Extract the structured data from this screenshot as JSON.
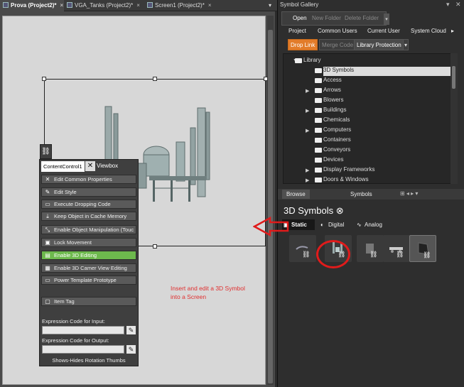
{
  "editor": {
    "tabs": [
      {
        "label": "Prova (Project2)*",
        "close": "×"
      },
      {
        "label": "VGA_Tanks (Project2)*",
        "close": "×"
      },
      {
        "label": "Screen1 (Project2)*",
        "close": "×"
      }
    ],
    "overflow": "▾"
  },
  "context_menu": {
    "title": "ContentControl1",
    "viewbox": "Viewbox",
    "items": [
      {
        "label": "Edit Common Properties",
        "icon": "wrench-icon",
        "glyph": "✕"
      },
      {
        "label": "Edit Style",
        "icon": "style-icon",
        "glyph": "✎"
      },
      {
        "label": "Execute Dropping Code",
        "icon": "code-icon",
        "glyph": "▭"
      },
      {
        "label": "Keep Object in Cache Memory",
        "icon": "download-icon",
        "glyph": "⤓"
      },
      {
        "label": "Enable Object Manipulation (Touc",
        "icon": "resize-icon",
        "glyph": "⤡"
      },
      {
        "label": "Lock Movement",
        "icon": "lock-icon",
        "glyph": "▣"
      },
      {
        "label": "Enable 3D Editing",
        "icon": "cube-icon",
        "glyph": "▤"
      },
      {
        "label": "Enable 3D Camer View Editing",
        "icon": "camera-icon",
        "glyph": "▦"
      },
      {
        "label": "Power Template Prototype",
        "icon": "template-icon",
        "glyph": "▭"
      },
      {
        "label": "Item Tag",
        "icon": "tag-icon",
        "glyph": "▢"
      }
    ],
    "input_label": "Expression Code for Input:",
    "output_label": "Expression Code for Output:",
    "input_value": "",
    "output_value": "",
    "footer": "Shows-Hides Rotation Thumbs",
    "active_color": "#6db94d"
  },
  "annotation": "Insert and edit a 3D Symbol into a Screen",
  "gallery": {
    "title": "Symbol Gallery",
    "pin": "▾",
    "close": "✕",
    "toolbar": {
      "open": "Open",
      "new_folder": "New Folder",
      "delete_folder": "Delete Folder",
      "more": "▾"
    },
    "nav_tabs": [
      "Project",
      "Common Users",
      "Current User",
      "System Cloud"
    ],
    "nav_more": "▸",
    "toolbar2": {
      "drop_link": "Drop Link",
      "merge_code": "Merge Code",
      "library_protection": "Library Protection",
      "more": "▾"
    },
    "tree": {
      "root": "Library",
      "items": [
        {
          "label": "3D Symbols",
          "expand": ""
        },
        {
          "label": "Access",
          "expand": ""
        },
        {
          "label": "Arrows",
          "expand": "▶"
        },
        {
          "label": "Blowers",
          "expand": ""
        },
        {
          "label": "Buildings",
          "expand": "▶"
        },
        {
          "label": "Chemicals",
          "expand": ""
        },
        {
          "label": "Computers",
          "expand": "▶"
        },
        {
          "label": "Containers",
          "expand": ""
        },
        {
          "label": "Conveyors",
          "expand": ""
        },
        {
          "label": "Devices",
          "expand": ""
        },
        {
          "label": "Display Frameworks",
          "expand": "▶"
        },
        {
          "label": "Doors & Windows",
          "expand": "▶"
        }
      ]
    },
    "bottom_tabs": [
      "Browse",
      "Symbols"
    ],
    "bottom_icons": "⊞ ◂ ▸ ▾",
    "symbols_title": "3D Symbols",
    "symbols_title_icon": "⊗",
    "symbol_tabs": [
      {
        "label": "Static",
        "icon": "image-icon",
        "glyph": "▣"
      },
      {
        "label": "Digital",
        "icon": "toggle-icon",
        "glyph": "◐"
      },
      {
        "label": "Analog",
        "icon": "wave-icon",
        "glyph": "∿"
      }
    ],
    "symbols": [
      "pipe-symbol",
      "refinery-symbol",
      "tank-symbol",
      "conveyor-symbol",
      "machine-symbol"
    ],
    "highlight_color": "#e01b1b",
    "accent_color": "#e27c2a"
  }
}
